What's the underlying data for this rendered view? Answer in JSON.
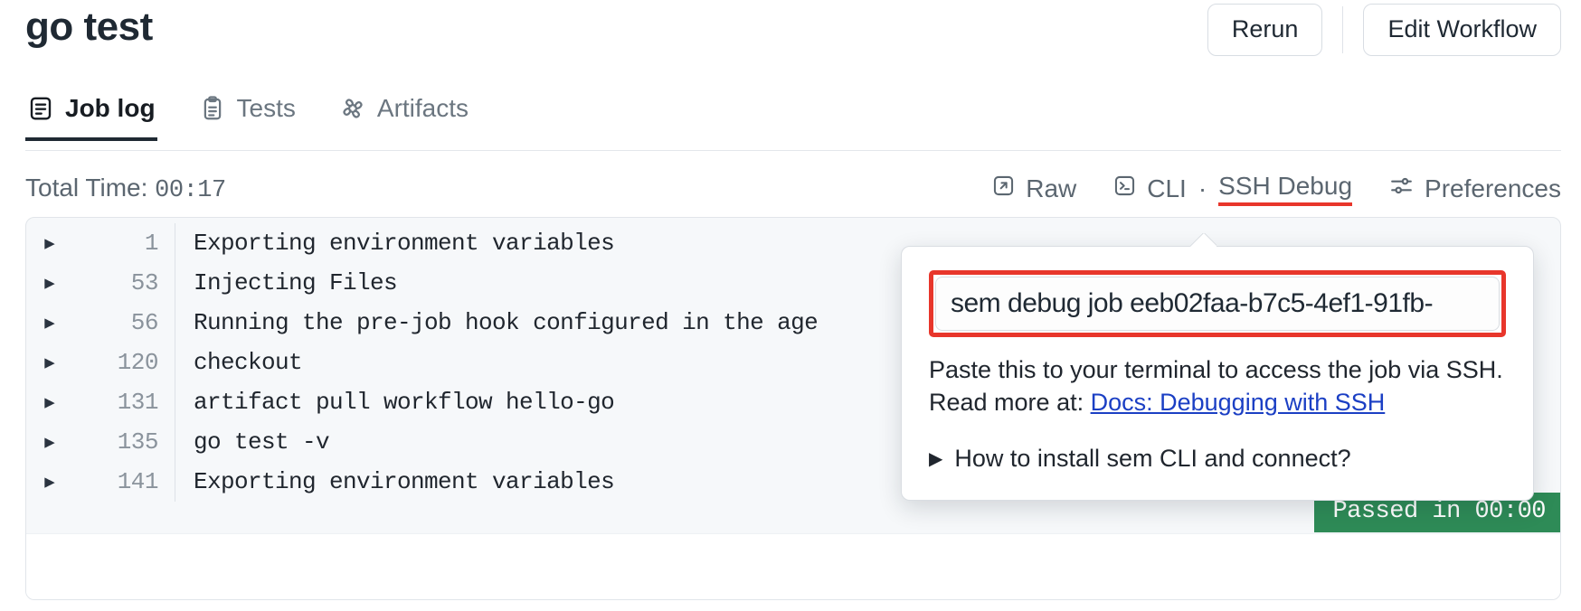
{
  "header": {
    "title": "go test",
    "actions": [
      {
        "label": "Rerun",
        "name": "rerun-button"
      },
      {
        "label": "Edit Workflow",
        "name": "edit-workflow-button"
      }
    ]
  },
  "tabs": [
    {
      "label": "Job log",
      "icon": "job-log-icon",
      "active": true
    },
    {
      "label": "Tests",
      "icon": "tests-clipboard-icon",
      "active": false
    },
    {
      "label": "Artifacts",
      "icon": "artifacts-icon",
      "active": false
    }
  ],
  "toolbar": {
    "total_time_label": "Total Time:",
    "total_time_value": "00:17",
    "raw_label": "Raw",
    "cli_label": "CLI",
    "separator": "·",
    "ssh_debug_label": "SSH Debug",
    "preferences_label": "Preferences"
  },
  "log": {
    "rows": [
      {
        "line": "1",
        "text": "Exporting environment variables"
      },
      {
        "line": "53",
        "text": "Injecting Files"
      },
      {
        "line": "56",
        "text": "Running the pre-job hook configured in the age"
      },
      {
        "line": "120",
        "text": "checkout"
      },
      {
        "line": "131",
        "text": "artifact pull workflow hello-go"
      },
      {
        "line": "135",
        "text": "go test -v"
      },
      {
        "line": "141",
        "text": "Exporting environment variables"
      }
    ],
    "status_badge": "Passed in 00:00"
  },
  "popover": {
    "command": "sem debug job eeb02faa-b7c5-4ef1-91fb-",
    "description_part1": "Paste this to your terminal to access the job via SSH. Read more at: ",
    "docs_link": "Docs: Debugging with SSH",
    "disclosure_label": "How to install sem CLI and connect?",
    "disclosure_caret": "▶"
  },
  "colors": {
    "accent_red": "#e8362b",
    "link_blue": "#1b3fc4",
    "pass_green": "#2e8b57",
    "text_dark": "#1f2933",
    "text_muted": "#5b6670"
  }
}
